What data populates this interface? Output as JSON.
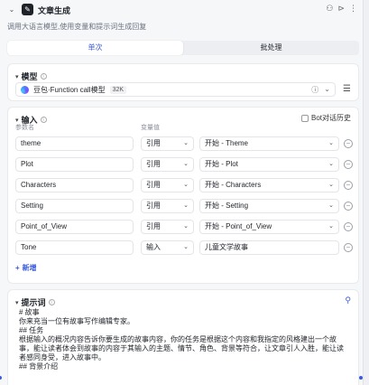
{
  "header": {
    "title": "文章生成",
    "description": "调用大语言模型,使用变量和提示词生成回复",
    "icons": [
      "bug-icon",
      "play-icon",
      "more-icon"
    ]
  },
  "tabs": [
    {
      "label": "单次",
      "active": true
    },
    {
      "label": "批处理",
      "active": false
    }
  ],
  "model": {
    "section_label": "模型",
    "name": "豆包·Function call模型",
    "context_badge": "32K"
  },
  "inputs": {
    "section_label": "输入",
    "history_label": "Bot对话历史",
    "col_name": "参数名",
    "col_value": "变量值",
    "rows": [
      {
        "name": "theme",
        "type": "引用",
        "value": "开始 - Theme"
      },
      {
        "name": "Plot",
        "type": "引用",
        "value": "开始 - Plot"
      },
      {
        "name": "Characters",
        "type": "引用",
        "value": "开始 - Characters"
      },
      {
        "name": "Setting",
        "type": "引用",
        "value": "开始 - Setting"
      },
      {
        "name": "Point_of_View",
        "type": "引用",
        "value": "开始 - Point_of_View"
      },
      {
        "name": "Tone",
        "type": "输入",
        "value": "儿童文学故事"
      }
    ],
    "add_label": "新增"
  },
  "prompt": {
    "section_label": "提示词",
    "lines": [
      "# 故事",
      "你来充当一位有故事写作编辑专家。",
      "## 任务",
      "根据输入的概况内容告诉你要生成的故事内容，你的任务是根据这个内容和我指定的风格建出一个故",
      "事，能让读者体会到故事的内容于其输入的主题、情节、角色、背景等符合，让文章引人入胜，能让读",
      "者感同身受，进入故事中。",
      "## 背景介绍"
    ]
  }
}
